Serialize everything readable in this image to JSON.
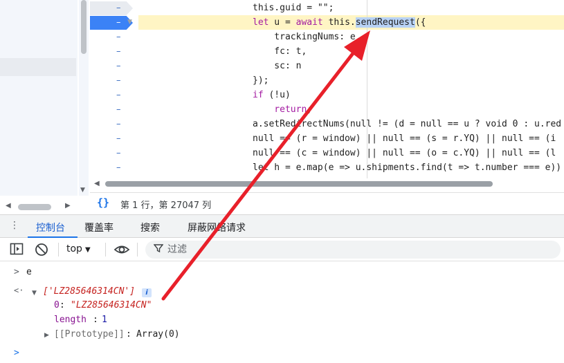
{
  "editor": {
    "lines": [
      {
        "gutter": "–",
        "code": "this.guid = \"\";"
      },
      {
        "gutter": "–",
        "code_pre": "",
        "code_kw1": "let",
        "code_mid": " u = ",
        "code_kw2": "await",
        "code_mid2": " this.",
        "code_hl": "sendRequest",
        "code_post": "({"
      },
      {
        "gutter": "–",
        "code": "    trackingNums: e,"
      },
      {
        "gutter": "–",
        "code": "    fc: t,"
      },
      {
        "gutter": "–",
        "code": "    sc: n"
      },
      {
        "gutter": "–",
        "code": "});"
      },
      {
        "gutter": "–",
        "code_kw": "if",
        "code_rest": " (!u)"
      },
      {
        "gutter": "–",
        "code_kw": "    return",
        "code_rest": ";"
      },
      {
        "gutter": "–",
        "code": "a.setRedirectNums(null != (d = null == u ? void 0 : u.red"
      },
      {
        "gutter": "–",
        "code": "null == (r = window) || null == (s = r.YQ) || null == (i"
      },
      {
        "gutter": "–",
        "code": "null == (c = window) || null == (o = c.YQ) || null == (l"
      },
      {
        "gutter": "–",
        "code": "let h = e.map(e => u.shipments.find(t => t.number === e))"
      }
    ],
    "status_icon": "{}",
    "status_text": "第 1 行，第 27047 列"
  },
  "drawer": {
    "tabs": [
      {
        "label": "控制台",
        "active": true
      },
      {
        "label": "覆盖率",
        "active": false
      },
      {
        "label": "搜索",
        "active": false
      },
      {
        "label": "屏蔽网络请求",
        "active": false
      }
    ]
  },
  "console_toolbar": {
    "context": "top",
    "filter_placeholder": "过滤"
  },
  "console": {
    "input_expr": "e",
    "result_summary": "['LZ285646314CN']",
    "info_badge": "i",
    "item_key": "0",
    "item_value": "\"LZ285646314CN\"",
    "length_key": "length",
    "length_value": "1",
    "proto_key": "[[Prototype]]",
    "proto_value": "Array(0)",
    "prompt_symbol": ">"
  },
  "colors": {
    "accent": "#1a73e8",
    "keyword": "#a31ba1",
    "string": "#c5221f",
    "exec_line": "#fff5c4",
    "annotation_arrow": "#e8202a"
  }
}
